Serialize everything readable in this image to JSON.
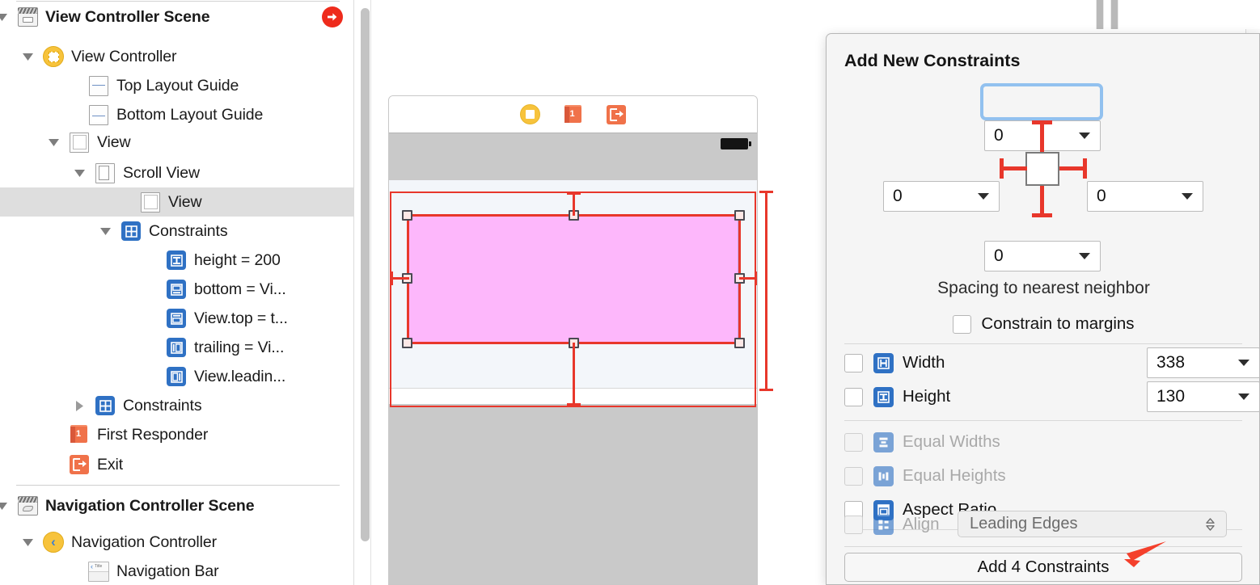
{
  "outline": {
    "rows": [
      {
        "label": "View Controller Scene",
        "icon": "scene-icon",
        "bold": true,
        "indent": 20,
        "twisty": "down",
        "selected": false,
        "badge": "initial-view-controller-badge"
      },
      {
        "label": "View Controller",
        "icon": "view-controller-icon",
        "bold": false,
        "indent": 52,
        "twisty": "down",
        "selected": false
      },
      {
        "label": "Top Layout Guide",
        "icon": "top-layout-guide-icon",
        "bold": false,
        "indent": 108,
        "twisty": "none",
        "selected": false
      },
      {
        "label": "Bottom Layout Guide",
        "icon": "bottom-layout-guide-icon",
        "bold": false,
        "indent": 108,
        "twisty": "none",
        "selected": false
      },
      {
        "label": "View",
        "icon": "view-icon",
        "bold": false,
        "indent": 84,
        "twisty": "down",
        "selected": false
      },
      {
        "label": "Scroll View",
        "icon": "scroll-view-icon",
        "bold": false,
        "indent": 116,
        "twisty": "down",
        "selected": false
      },
      {
        "label": "View",
        "icon": "view-icon",
        "bold": false,
        "indent": 172,
        "twisty": "none",
        "selected": true
      },
      {
        "label": "Constraints",
        "icon": "constraints-icon",
        "bold": false,
        "indent": 148,
        "twisty": "down",
        "selected": false
      },
      {
        "label": "height = 200",
        "icon": "constraint-height-icon",
        "bold": false,
        "indent": 204,
        "twisty": "none",
        "selected": false
      },
      {
        "label": "bottom = Vi...",
        "icon": "constraint-bottom-icon",
        "bold": false,
        "indent": 204,
        "twisty": "none",
        "selected": false
      },
      {
        "label": "View.top = t...",
        "icon": "constraint-top-icon",
        "bold": false,
        "indent": 204,
        "twisty": "none",
        "selected": false
      },
      {
        "label": "trailing = Vi...",
        "icon": "constraint-trailing-icon",
        "bold": false,
        "indent": 204,
        "twisty": "none",
        "selected": false
      },
      {
        "label": "View.leadin...",
        "icon": "constraint-leading-icon",
        "bold": false,
        "indent": 204,
        "twisty": "none",
        "selected": false
      },
      {
        "label": "Constraints",
        "icon": "constraints-icon",
        "bold": false,
        "indent": 116,
        "twisty": "right",
        "selected": false
      },
      {
        "label": "First Responder",
        "icon": "first-responder-icon",
        "bold": false,
        "indent": 84,
        "twisty": "none",
        "selected": false
      },
      {
        "label": "Exit",
        "icon": "exit-icon",
        "bold": false,
        "indent": 84,
        "twisty": "none",
        "selected": false
      },
      {
        "label": "Navigation Controller Scene",
        "icon": "nav-scene-icon",
        "bold": true,
        "indent": 20,
        "twisty": "down",
        "selected": false
      },
      {
        "label": "Navigation Controller",
        "icon": "navigation-controller-icon",
        "bold": false,
        "indent": 52,
        "twisty": "down",
        "selected": false
      },
      {
        "label": "Navigation Bar",
        "icon": "navigation-bar-icon",
        "bold": false,
        "indent": 108,
        "twisty": "none",
        "selected": false
      }
    ]
  },
  "canvas": {
    "dock": [
      {
        "name": "view-controller-dock-icon"
      },
      {
        "name": "first-responder-dock-icon"
      },
      {
        "name": "exit-dock-icon"
      }
    ]
  },
  "popover": {
    "title": "Add New Constraints",
    "spacing": {
      "top": "0",
      "leading": "0",
      "trailing": "0",
      "bottom": "0",
      "caption": "Spacing to nearest neighbor",
      "constrain_to_margins_label": "Constrain to margins",
      "constrain_to_margins_checked": false
    },
    "size_rows": [
      {
        "label": "Width",
        "icon": "width-constraint-icon",
        "checked": false,
        "disabled": false,
        "value": "338"
      },
      {
        "label": "Height",
        "icon": "height-constraint-icon",
        "checked": false,
        "disabled": false,
        "value": "130"
      }
    ],
    "relation_rows": [
      {
        "label": "Equal Widths",
        "icon": "equal-widths-icon",
        "checked": false,
        "disabled": true
      },
      {
        "label": "Equal Heights",
        "icon": "equal-heights-icon",
        "checked": false,
        "disabled": true
      },
      {
        "label": "Aspect Ratio",
        "icon": "aspect-ratio-icon",
        "checked": false,
        "disabled": false
      }
    ],
    "align": {
      "label": "Align",
      "icon": "align-icon",
      "checked": false,
      "disabled": true,
      "selected_option": "Leading Edges"
    },
    "add_button_label": "Add 4 Constraints"
  },
  "colors": {
    "accent_blue": "#2f71c4",
    "focus_ring": "#92c1ef",
    "constraint_red": "#e8372b",
    "annotation_red": "#f4402c",
    "selection_pink": "#fdb7fb",
    "scene_yellow": "#f7c33c",
    "object_orange": "#f0724a",
    "initial_badge_red": "#ee2b1c"
  }
}
